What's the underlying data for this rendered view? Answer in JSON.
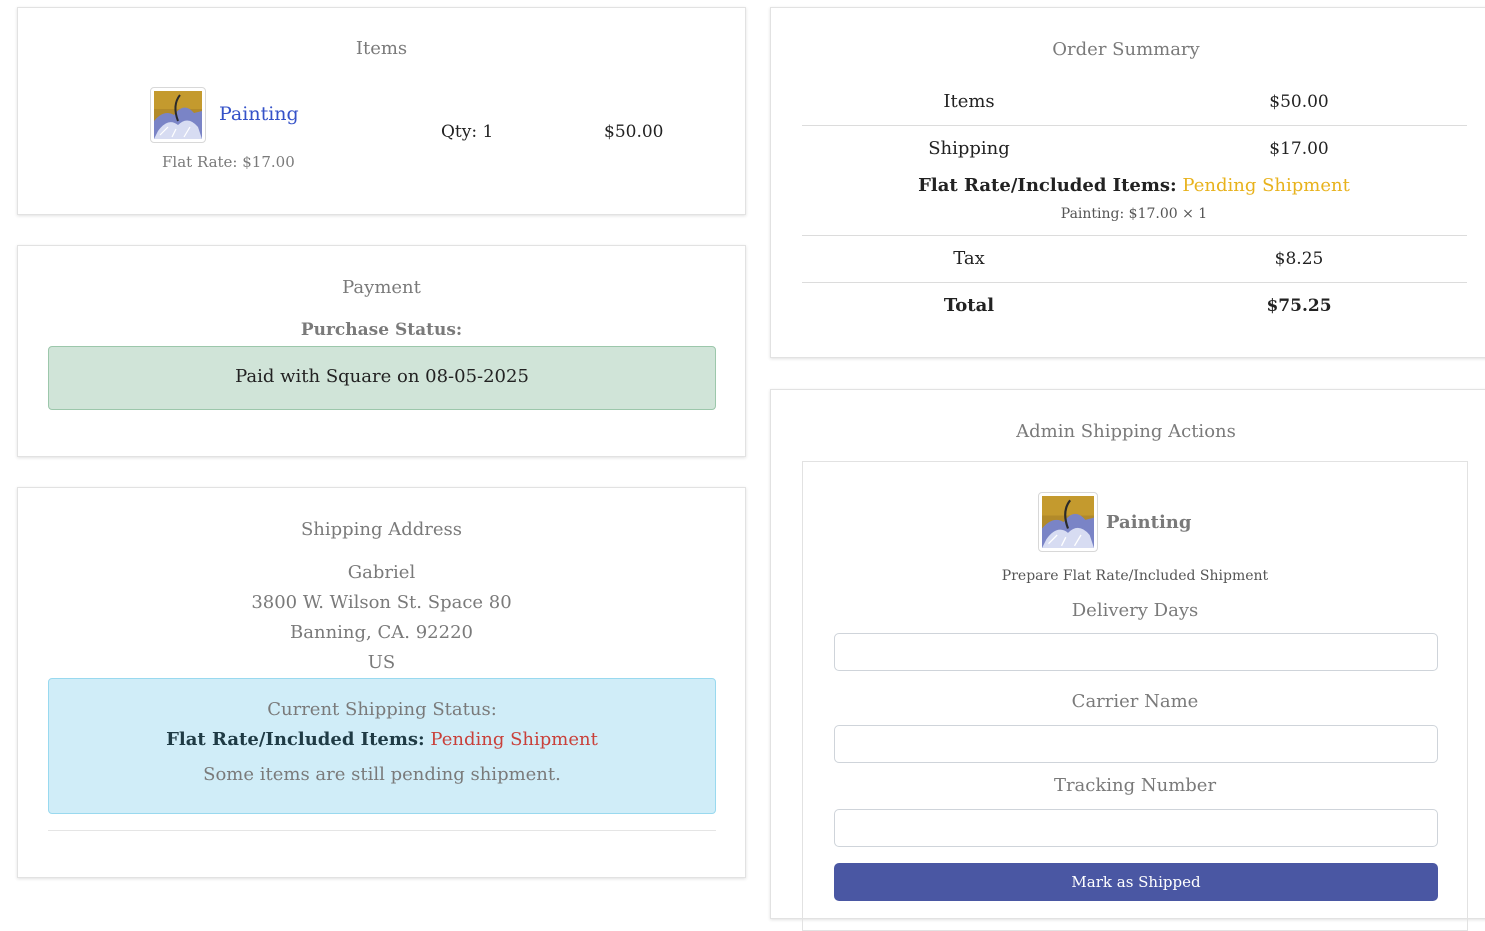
{
  "items_card": {
    "title": "Items",
    "item": {
      "name": "Painting",
      "rate": "Flat Rate: $17.00",
      "qty": "Qty: 1",
      "price": "$50.00"
    }
  },
  "payment_card": {
    "title": "Payment",
    "status_label": "Purchase Status:",
    "status_text": "Paid with Square on 08-05-2025"
  },
  "address_card": {
    "title": "Shipping Address",
    "lines": [
      "Gabriel",
      "3800 W. Wilson St. Space 80",
      "Banning, CA. 92220",
      "US"
    ],
    "status_heading": "Current Shipping Status:",
    "status_label": "Flat Rate/Included Items:",
    "status_value": "Pending Shipment",
    "status_note": "Some items are still pending shipment."
  },
  "summary_card": {
    "title": "Order Summary",
    "items_label": "Items",
    "items_value": "$50.00",
    "shipping_label": "Shipping",
    "shipping_value": "$17.00",
    "shipping_detail_label": "Flat Rate/Included Items:",
    "shipping_detail_status": "Pending Shipment",
    "shipping_line": "Painting: $17.00 × 1",
    "tax_label": "Tax",
    "tax_value": "$8.25",
    "total_label": "Total",
    "total_value": "$75.25"
  },
  "admin_card": {
    "title": "Admin Shipping Actions",
    "item_name": "Painting",
    "prepare_text": "Prepare Flat Rate/Included Shipment",
    "delivery_label": "Delivery Days",
    "carrier_label": "Carrier Name",
    "tracking_label": "Tracking Number",
    "delivery_value": "",
    "carrier_value": "",
    "tracking_value": "",
    "button_label": "Mark as Shipped"
  },
  "colors": {
    "link": "#3552c8",
    "pending_yellow": "#e8b21c",
    "pending_red": "#c9403a",
    "success_bg": "#d0e4d8",
    "info_bg": "#d0edf8",
    "button": "#4a57a3"
  },
  "icons": [
    "painting-thumbnail"
  ]
}
